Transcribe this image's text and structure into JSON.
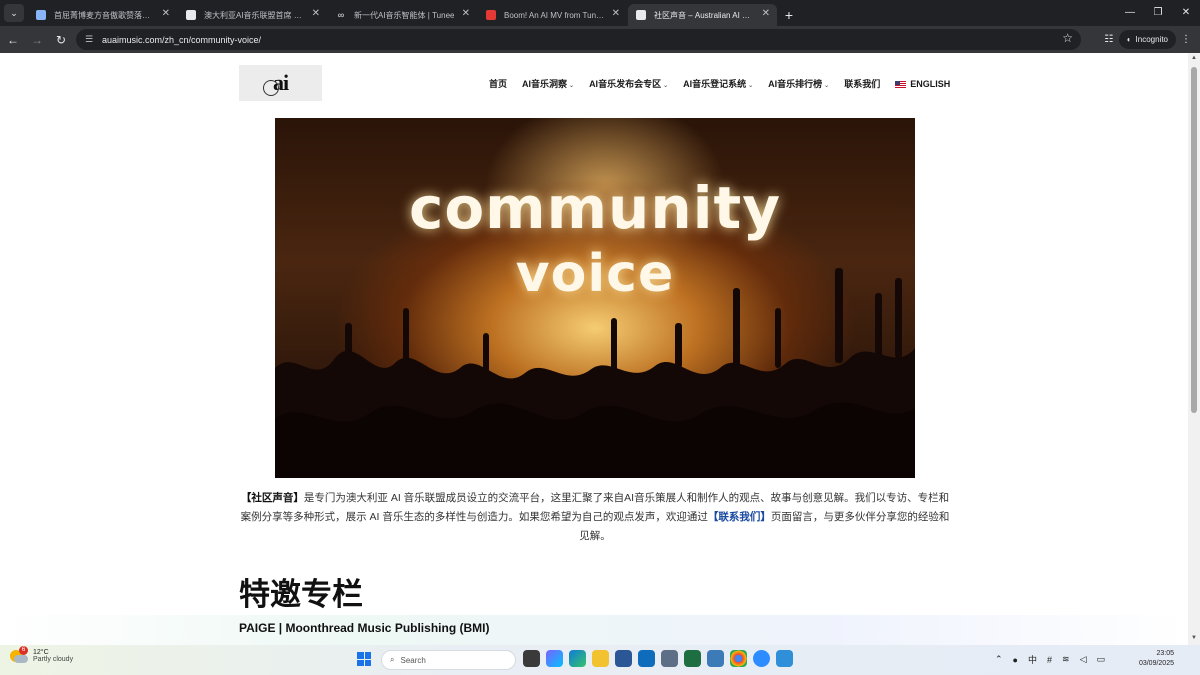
{
  "browser": {
    "tabs": [
      {
        "title": "首屈菁博麦方音傲歌赞落盖多",
        "favicon": "ct"
      },
      {
        "title": "澳大利亚AI音乐联盟首席 Future",
        "favicon": "doc"
      },
      {
        "title": "新一代AI音乐智能体 | Tunee",
        "favicon": "loop"
      },
      {
        "title": "Boom! An AI MV from Tunee Is",
        "favicon": "youtube"
      },
      {
        "title": "社区声音 – Australian AI Music",
        "favicon": "doc",
        "active": true
      }
    ],
    "url": "auaimusic.com/zh_cn/community-voice/",
    "incognito_label": "Incognito"
  },
  "site": {
    "logo_text": "ai",
    "nav": [
      {
        "label": "首页",
        "dropdown": false
      },
      {
        "label": "AI音乐洞察",
        "dropdown": true
      },
      {
        "label": "AI音乐发布会专区",
        "dropdown": true
      },
      {
        "label": "AI音乐登记系统",
        "dropdown": true
      },
      {
        "label": "AI音乐排行榜",
        "dropdown": true
      },
      {
        "label": "联系我们",
        "dropdown": false
      },
      {
        "label": "ENGLISH",
        "dropdown": false
      }
    ],
    "hero": {
      "line1": "community",
      "line2": "voice"
    },
    "intro": {
      "bold": "【社区声音】",
      "text1": "是专门为澳大利亚 AI 音乐联盟成员设立的交流平台，这里汇聚了来自AI音乐策展人和制作人的观点、故事与创意见解。我们以专访、专栏和案例分享等多种形式，展示 AI 音乐生态的多样性与创造力。如果您希望为自己的观点发声，欢迎通过",
      "link": "【联系我们】",
      "text2": "页面留言，与更多伙伴分享您的经验和见解。"
    },
    "section_title": "特邀专栏",
    "article_title": "PAIGE | Moonthread Music Publishing (BMI)"
  },
  "taskbar": {
    "weather_temp": "12°C",
    "weather_desc": "Partly cloudy",
    "weather_badge": "6",
    "search_placeholder": "Search",
    "tray_ime": "中",
    "time": "23:05",
    "date": "03/09/2025"
  }
}
